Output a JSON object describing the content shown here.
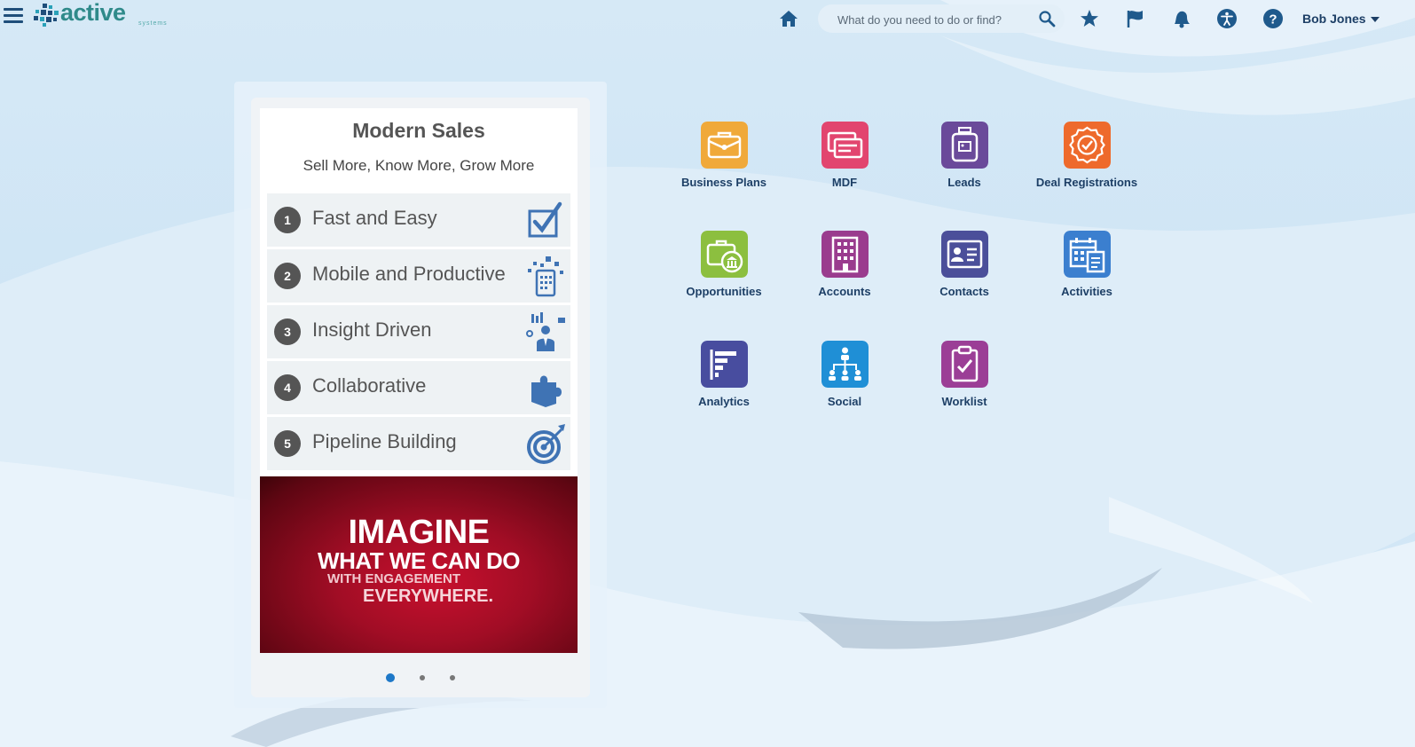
{
  "header": {
    "brand": "active",
    "brand_sub": "systems",
    "search_placeholder": "What do you need to do or find?",
    "icons": [
      "home-icon",
      "search-icon",
      "star-icon",
      "flag-icon",
      "bell-icon",
      "accessibility-icon",
      "help-icon"
    ],
    "user_name": "Bob Jones"
  },
  "carousel": {
    "title": "Modern Sales",
    "subtitle": "Sell More, Know More, Grow More",
    "items": [
      {
        "num": "1",
        "label": "Fast and Easy"
      },
      {
        "num": "2",
        "label": "Mobile and Productive"
      },
      {
        "num": "3",
        "label": "Insight Driven"
      },
      {
        "num": "4",
        "label": "Collaborative"
      },
      {
        "num": "5",
        "label": "Pipeline Building"
      }
    ],
    "promo": {
      "line1": "IMAGINE",
      "line2": "WHAT WE CAN DO",
      "line3": "WITH ENGAGEMENT",
      "line4": "EVERYWHERE."
    },
    "pages": 3,
    "active_page": 1
  },
  "springboard": {
    "tiles": [
      {
        "label": "Business Plans",
        "color": "#f0a93a",
        "icon": "briefcase-icon"
      },
      {
        "label": "MDF",
        "color": "#e2456f",
        "icon": "cards-icon"
      },
      {
        "label": "Leads",
        "color": "#6a4a9a",
        "icon": "jar-icon"
      },
      {
        "label": "Deal Registrations",
        "color": "#ee6a2c",
        "icon": "badge-icon"
      },
      {
        "label": "Opportunities",
        "color": "#8cbf3f",
        "icon": "bank-icon"
      },
      {
        "label": "Accounts",
        "color": "#9a3c8e",
        "icon": "building-icon"
      },
      {
        "label": "Contacts",
        "color": "#4b4f9a",
        "icon": "id-card-icon"
      },
      {
        "label": "Activities",
        "color": "#3b7fcf",
        "icon": "calendar-icon"
      },
      {
        "label": "Analytics",
        "color": "#484d9f",
        "icon": "chart-icon"
      },
      {
        "label": "Social",
        "color": "#1f8fd6",
        "icon": "network-icon"
      },
      {
        "label": "Worklist",
        "color": "#9b3e96",
        "icon": "clipboard-icon"
      }
    ]
  }
}
